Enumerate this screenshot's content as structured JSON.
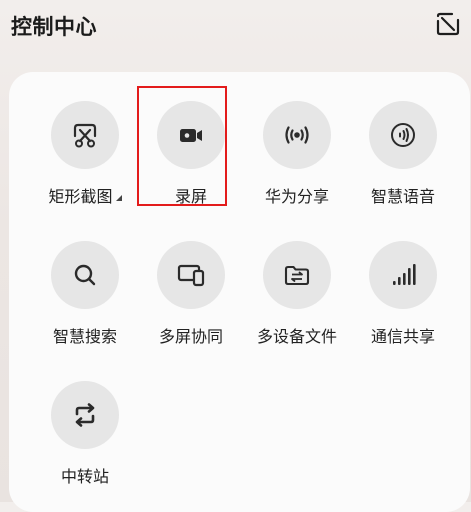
{
  "header": {
    "title": "控制中心"
  },
  "tiles": [
    {
      "label": "矩形截图",
      "icon": "screenshot-scissors-icon"
    },
    {
      "label": "录屏",
      "icon": "screen-record-camera-icon"
    },
    {
      "label": "华为分享",
      "icon": "huawei-share-icon"
    },
    {
      "label": "智慧语音",
      "icon": "smart-voice-icon"
    },
    {
      "label": "智慧搜索",
      "icon": "search-icon"
    },
    {
      "label": "多屏协同",
      "icon": "multi-screen-icon"
    },
    {
      "label": "多设备文件",
      "icon": "multi-device-folder-icon"
    },
    {
      "label": "通信共享",
      "icon": "signal-bars-icon"
    },
    {
      "label": "中转站",
      "icon": "transfer-station-icon"
    }
  ],
  "colors": {
    "icon": "#2b2b2b",
    "highlight": "#e31b1b",
    "tile_bg": "#e6e6e6"
  }
}
